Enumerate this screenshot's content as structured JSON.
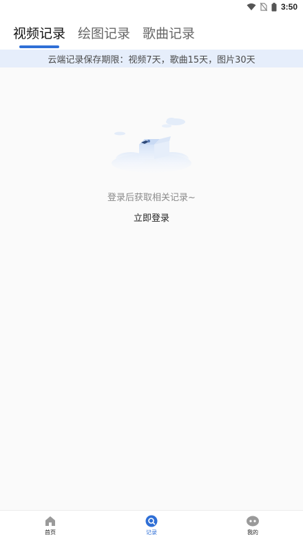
{
  "status_bar": {
    "time": "3:50",
    "icons": [
      "wifi-icon",
      "no-sim-icon",
      "battery-icon"
    ]
  },
  "tabs": [
    {
      "label": "视频记录",
      "active": true
    },
    {
      "label": "绘图记录",
      "active": false
    },
    {
      "label": "歌曲记录",
      "active": false
    }
  ],
  "notice": "云端记录保存期限：视频7天，歌曲15天，图片30天",
  "empty_state": {
    "icon": "empty-box-icon",
    "message": "登录后获取相关记录~",
    "login_label": "立即登录"
  },
  "bottom_nav": [
    {
      "label": "首页",
      "icon": "home-icon",
      "active": false
    },
    {
      "label": "记录",
      "icon": "records-icon",
      "active": true
    },
    {
      "label": "我的",
      "icon": "profile-icon",
      "active": false
    }
  ],
  "colors": {
    "accent": "#2f6fd6",
    "notice_bg": "#e6eefb",
    "page_bg": "#fafafa"
  }
}
